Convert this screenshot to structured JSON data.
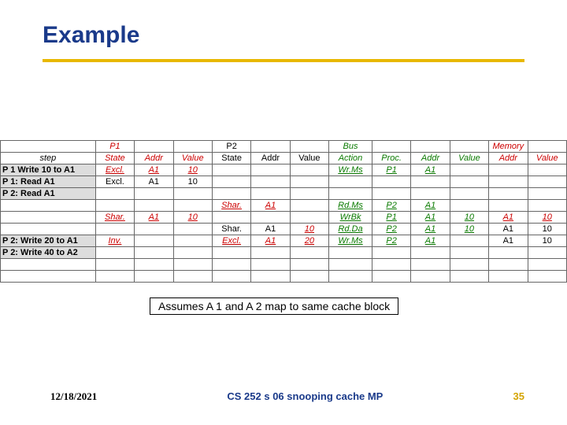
{
  "title": "Example",
  "caption": "Assumes A 1 and A 2 map to same cache block",
  "footer": {
    "date": "12/18/2021",
    "title": "CS 252 s 06 snooping cache MP",
    "page": "35"
  },
  "group_headers": {
    "p1": "P1",
    "p2": "P2",
    "bus": "Bus",
    "memory": "Memory"
  },
  "headers": {
    "step": "step",
    "p1_state": "State",
    "p1_addr": "Addr",
    "p1_value": "Value",
    "p2_state": "State",
    "p2_addr": "Addr",
    "p2_value": "Value",
    "bus_action": "Action",
    "bus_proc": "Proc.",
    "bus_addr": "Addr",
    "bus_value": "Value",
    "mem_addr": "Addr",
    "mem_value": "Value"
  },
  "rows": [
    {
      "step": "P 1 Write 10 to A1",
      "p1_state": "Excl.",
      "p1_addr": "A1",
      "p1_value": "10",
      "p2_state": "",
      "p2_addr": "",
      "p2_value": "",
      "bus_action": "Wr.Ms",
      "bus_proc": "P1",
      "bus_addr": "A1",
      "bus_value": "",
      "mem_addr": "",
      "mem_value": "",
      "changed": true,
      "shade": true
    },
    {
      "step": "P 1: Read A1",
      "p1_state": "Excl.",
      "p1_addr": "A1",
      "p1_value": "10",
      "p2_state": "",
      "p2_addr": "",
      "p2_value": "",
      "bus_action": "",
      "bus_proc": "",
      "bus_addr": "",
      "bus_value": "",
      "mem_addr": "",
      "mem_value": "",
      "changed": false,
      "shade": true
    },
    {
      "step": "P 2: Read A1",
      "p1_state": "",
      "p1_addr": "",
      "p1_value": "",
      "p2_state": "",
      "p2_addr": "",
      "p2_value": "",
      "bus_action": "",
      "bus_proc": "",
      "bus_addr": "",
      "bus_value": "",
      "mem_addr": "",
      "mem_value": "",
      "changed": false,
      "shade": true
    },
    {
      "step": "",
      "p1_state": "",
      "p1_addr": "",
      "p1_value": "",
      "p2_state": "Shar.",
      "p2_addr": "A1",
      "p2_value": "",
      "bus_action": "Rd.Ms",
      "bus_proc": "P2",
      "bus_addr": "A1",
      "bus_value": "",
      "mem_addr": "",
      "mem_value": "",
      "changed": true,
      "shade": false
    },
    {
      "step": "",
      "p1_state": "Shar.",
      "p1_addr": "A1",
      "p1_value": "10",
      "p2_state": "",
      "p2_addr": "",
      "p2_value": "",
      "bus_action": "WrBk",
      "bus_proc": "P1",
      "bus_addr": "A1",
      "bus_value": "10",
      "mem_addr": "A1",
      "mem_value": "10",
      "changed": true,
      "shade": false
    },
    {
      "step": "",
      "p1_state": "",
      "p1_addr": "",
      "p1_value": "",
      "p2_state": "Shar.",
      "p2_addr": "A1",
      "p2_value": "10",
      "bus_action": "Rd.Da",
      "bus_proc": "P2",
      "bus_addr": "A1",
      "bus_value": "10",
      "mem_addr": "A1",
      "mem_value": "10",
      "changed_p2v": true,
      "shade": false
    },
    {
      "step": "P 2: Write 20 to A1",
      "p1_state": "Inv.",
      "p1_addr": "",
      "p1_value": "",
      "p2_state": "Excl.",
      "p2_addr": "A1",
      "p2_value": "20",
      "bus_action": "Wr.Ms",
      "bus_proc": "P2",
      "bus_addr": "A1",
      "bus_value": "",
      "mem_addr": "A1",
      "mem_value": "10",
      "p1_changed": true,
      "p2_changed": true,
      "shade": true
    },
    {
      "step": "P 2: Write 40 to A2",
      "p1_state": "",
      "p1_addr": "",
      "p1_value": "",
      "p2_state": "",
      "p2_addr": "",
      "p2_value": "",
      "bus_action": "",
      "bus_proc": "",
      "bus_addr": "",
      "bus_value": "",
      "mem_addr": "",
      "mem_value": "",
      "changed": false,
      "shade": true
    }
  ]
}
